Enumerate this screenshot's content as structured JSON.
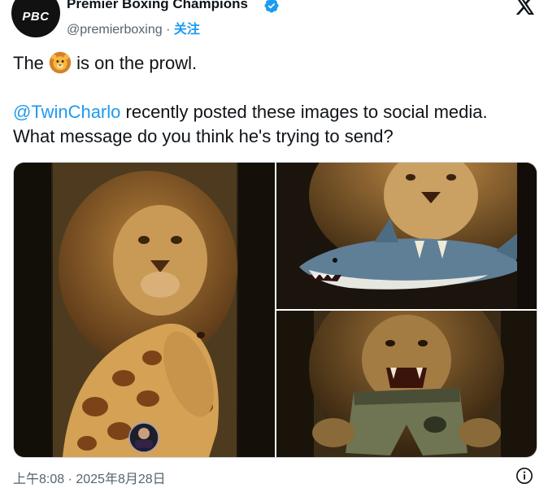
{
  "account": {
    "display_name": "Premier Boxing Champions",
    "handle": "@premierboxing",
    "separator": " · ",
    "follow_label": "关注",
    "avatar_logo_text": "PBC"
  },
  "tweet": {
    "line1_before": "The ",
    "line1_emoji": "lion-face-emoji",
    "line1_after": " is on the prowl.",
    "mention": "@TwinCharlo",
    "line2_after": " recently posted these images to social media. What message do you think he's trying to send?"
  },
  "media": {
    "images": [
      {
        "name": "lion-with-giraffe-painting"
      },
      {
        "name": "lion-biting-shark-painting"
      },
      {
        "name": "lion-tearing-eagle-shorts-painting"
      }
    ]
  },
  "footer": {
    "timestamp": "上午8:08 · 2025年8月28日"
  },
  "colors": {
    "link": "#1d9bf0",
    "text": "#0f1419",
    "muted": "#536471",
    "border": "#cfd9de"
  }
}
